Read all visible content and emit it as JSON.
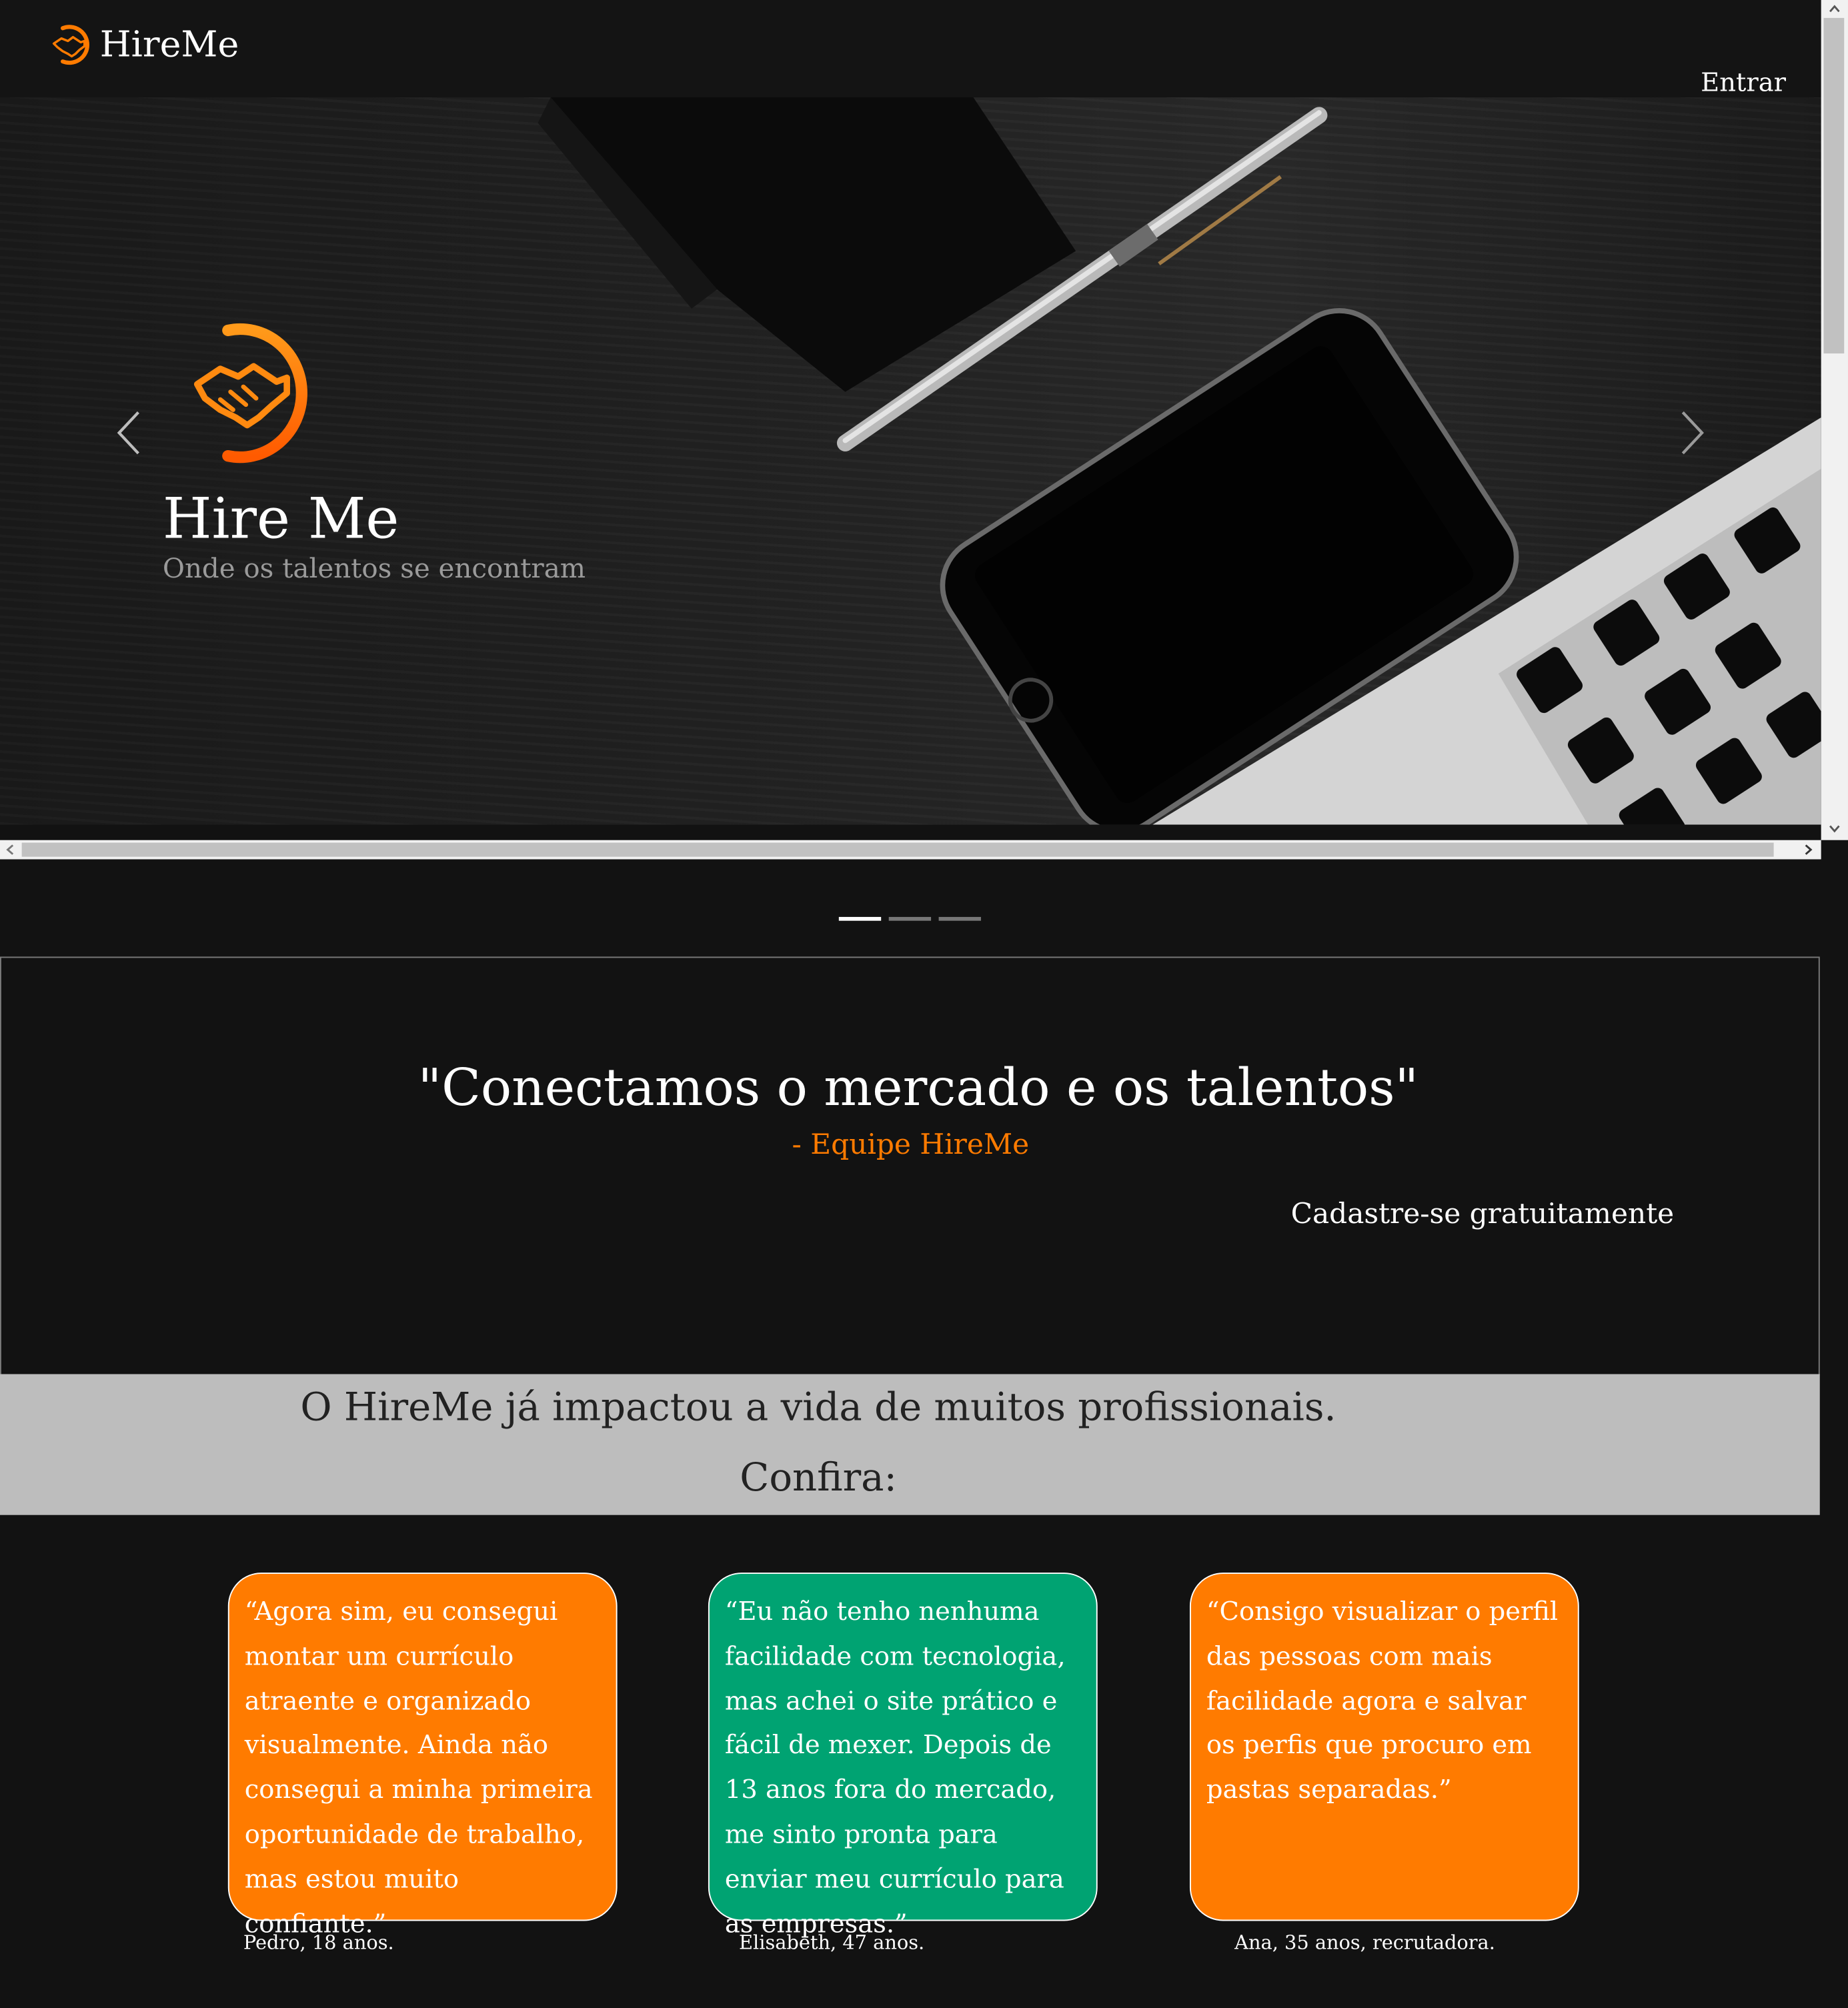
{
  "header": {
    "brand": "HireMe",
    "login": "Entrar"
  },
  "hero": {
    "title": "Hire Me",
    "subtitle": "Onde os talentos se encontram",
    "slides_total": 3,
    "active_slide": 1
  },
  "quote": {
    "text": "\"Conectamos o mercado e os talentos\"",
    "author": "- Equipe HireMe",
    "cta": "Cadastre-se gratuitamente"
  },
  "impact": {
    "line1": "O HireMe já impactou a vida de muitos profissionais.",
    "line2": "Confira:"
  },
  "testimonials": [
    {
      "text": "“Agora sim, eu consegui montar um currículo atraente e organizado visualmente. Ainda não consegui a minha primeira oportunidade de trabalho, mas estou muito confiante.”",
      "author": "Pedro, 18 anos."
    },
    {
      "text": "“Eu não tenho nenhuma facilidade com tecnologia, mas achei o site prático e fácil de mexer. Depois de 13 anos fora do mercado, me sinto pronta para enviar meu currículo para as empresas.”",
      "author": "Elisabeth, 47 anos."
    },
    {
      "text": "“Consigo visualizar o perfil das pessoas com mais facilidade agora e salvar os perfis que procuro em pastas separadas.”",
      "author": "Ana, 35 anos, recrutadora."
    }
  ],
  "colors": {
    "accent": "#ff7b00",
    "green": "#00a372",
    "background": "#121212",
    "band": "#bdbdbd"
  },
  "icons": {
    "logo": "handshake-circle-icon",
    "prev": "chevron-left-icon",
    "next": "chevron-right-icon"
  }
}
